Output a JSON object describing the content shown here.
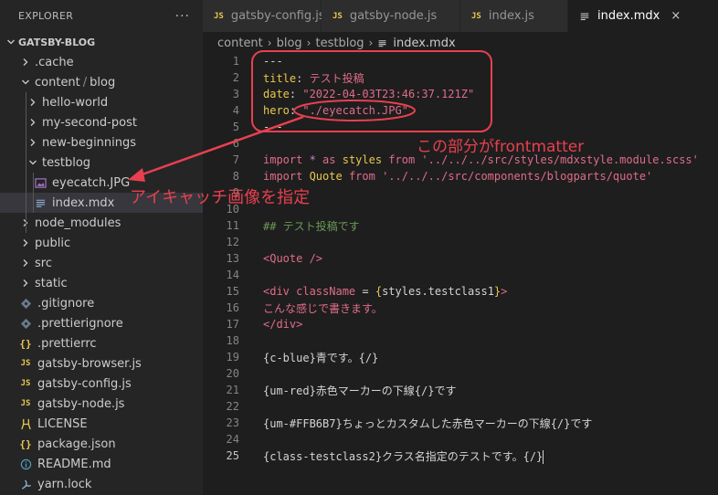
{
  "sidebar": {
    "header": "EXPLORER",
    "more": "···",
    "project": "GATSBY-BLOG",
    "items": [
      {
        "label": ".cache",
        "type": "folder",
        "depth": 1,
        "expanded": false
      },
      {
        "label": "content",
        "label2": "blog",
        "type": "folder",
        "depth": 1,
        "expanded": true
      },
      {
        "label": "hello-world",
        "type": "folder",
        "depth": 2,
        "expanded": false
      },
      {
        "label": "my-second-post",
        "type": "folder",
        "depth": 2,
        "expanded": false
      },
      {
        "label": "new-beginnings",
        "type": "folder",
        "depth": 2,
        "expanded": false
      },
      {
        "label": "testblog",
        "type": "folder",
        "depth": 2,
        "expanded": true
      },
      {
        "label": "eyecatch.JPG",
        "type": "image",
        "depth": 3
      },
      {
        "label": "index.mdx",
        "type": "mdx",
        "depth": 3,
        "selected": true
      },
      {
        "label": "node_modules",
        "type": "folder",
        "depth": 1,
        "expanded": false
      },
      {
        "label": "public",
        "type": "folder",
        "depth": 1,
        "expanded": false
      },
      {
        "label": "src",
        "type": "folder",
        "depth": 1,
        "expanded": false
      },
      {
        "label": "static",
        "type": "folder",
        "depth": 1,
        "expanded": false
      },
      {
        "label": ".gitignore",
        "type": "git",
        "depth": 1
      },
      {
        "label": ".prettierignore",
        "type": "git",
        "depth": 1
      },
      {
        "label": ".prettierrc",
        "type": "json",
        "depth": 1
      },
      {
        "label": "gatsby-browser.js",
        "type": "js",
        "depth": 1
      },
      {
        "label": "gatsby-config.js",
        "type": "js",
        "depth": 1
      },
      {
        "label": "gatsby-node.js",
        "type": "js",
        "depth": 1
      },
      {
        "label": "LICENSE",
        "type": "license",
        "depth": 1
      },
      {
        "label": "package.json",
        "type": "json",
        "depth": 1
      },
      {
        "label": "README.md",
        "type": "info",
        "depth": 1
      },
      {
        "label": "yarn.lock",
        "type": "yarn",
        "depth": 1
      }
    ]
  },
  "tabs": [
    {
      "label": "gatsby-config.js",
      "icon": "JS",
      "active": false
    },
    {
      "label": "gatsby-node.js",
      "icon": "JS",
      "active": false
    },
    {
      "label": "index.js",
      "icon": "JS",
      "active": false
    },
    {
      "label": "index.mdx",
      "icon": "mdx",
      "active": true,
      "close": "×"
    }
  ],
  "breadcrumb": {
    "parts": [
      "content",
      "blog",
      "testblog"
    ],
    "file": "index.mdx"
  },
  "editor": {
    "current_line": 25,
    "lines": [
      {
        "n": "1",
        "tokens": [
          [
            "---",
            "c-punct"
          ]
        ]
      },
      {
        "n": "2",
        "tokens": [
          [
            "title",
            "c-key"
          ],
          [
            ": ",
            "c-punct"
          ],
          [
            "テスト投稿",
            "c-pink"
          ]
        ]
      },
      {
        "n": "3",
        "tokens": [
          [
            "date",
            "c-key"
          ],
          [
            ": ",
            "c-punct"
          ],
          [
            "\"2022-04-03T23:46:37.121Z\"",
            "c-pink"
          ]
        ]
      },
      {
        "n": "4",
        "tokens": [
          [
            "hero",
            "c-key"
          ],
          [
            ": ",
            "c-punct"
          ],
          [
            "\"./eyecatch.JPG\"",
            "c-pink"
          ]
        ]
      },
      {
        "n": "5",
        "tokens": [
          [
            "---",
            "c-punct"
          ]
        ]
      },
      {
        "n": "6",
        "tokens": []
      },
      {
        "n": "7",
        "tokens": [
          [
            "import",
            "c-pink"
          ],
          [
            " * ",
            "c-kw"
          ],
          [
            "as",
            "c-pink"
          ],
          [
            " styles ",
            "c-id"
          ],
          [
            "from",
            "c-pink"
          ],
          [
            " '../../../src/styles/mdxstyle.module.scss'",
            "c-pink"
          ]
        ]
      },
      {
        "n": "8",
        "tokens": [
          [
            "import",
            "c-pink"
          ],
          [
            " Quote ",
            "c-id"
          ],
          [
            "from",
            "c-pink"
          ],
          [
            " '../../../src/components/blogparts/quote'",
            "c-pink"
          ]
        ]
      },
      {
        "n": "9",
        "tokens": []
      },
      {
        "n": "10",
        "tokens": []
      },
      {
        "n": "11",
        "tokens": [
          [
            "## テスト投稿です",
            "c-head"
          ]
        ]
      },
      {
        "n": "12",
        "tokens": []
      },
      {
        "n": "13",
        "tokens": [
          [
            "<Quote />",
            "c-tag"
          ]
        ]
      },
      {
        "n": "14",
        "tokens": []
      },
      {
        "n": "15",
        "tokens": [
          [
            "<div ",
            "c-tag"
          ],
          [
            "className",
            "c-pink"
          ],
          [
            " = ",
            "c-plain"
          ],
          [
            "{",
            "c-id"
          ],
          [
            "styles",
            "c-plain"
          ],
          [
            ".",
            "c-plain"
          ],
          [
            "testclass1",
            "c-plain"
          ],
          [
            "}",
            "c-id"
          ],
          [
            ">",
            "c-tag"
          ]
        ]
      },
      {
        "n": "16",
        "tokens": [
          [
            "こんな感じで書きます。",
            "c-pink"
          ]
        ]
      },
      {
        "n": "17",
        "tokens": [
          [
            "</div>",
            "c-tag"
          ]
        ]
      },
      {
        "n": "18",
        "tokens": []
      },
      {
        "n": "19",
        "tokens": [
          [
            "{c-blue}青です。{/}",
            "c-jp"
          ]
        ]
      },
      {
        "n": "20",
        "tokens": []
      },
      {
        "n": "21",
        "tokens": [
          [
            "{um-red}赤色マーカーの下線{/}です",
            "c-jp"
          ]
        ]
      },
      {
        "n": "22",
        "tokens": []
      },
      {
        "n": "23",
        "tokens": [
          [
            "{um-#FFB6B7}ちょっとカスタムした赤色マーカーの下線{/}です",
            "c-jp"
          ]
        ]
      },
      {
        "n": "24",
        "tokens": []
      },
      {
        "n": "25",
        "tokens": [
          [
            "{class-testclass2}クラス名指定のテストです。{/}",
            "c-jp"
          ]
        ]
      }
    ]
  },
  "annotations": {
    "frontmatter_label": "この部分がfrontmatter",
    "eyecatch_label": "アイキャッチ画像を指定",
    "color": "#e8404f"
  }
}
